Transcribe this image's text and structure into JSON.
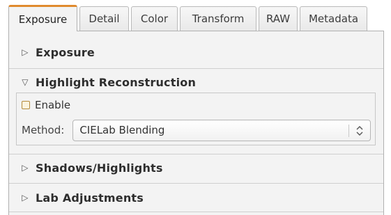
{
  "tabs": [
    {
      "label": "Exposure",
      "active": true
    },
    {
      "label": "Detail",
      "active": false
    },
    {
      "label": "Color",
      "active": false
    },
    {
      "label": "Transform",
      "active": false
    },
    {
      "label": "RAW",
      "active": false
    },
    {
      "label": "Metadata",
      "active": false
    }
  ],
  "sections": {
    "exposure": {
      "title": "Exposure",
      "expanded": false,
      "icon": "triangle-right-icon"
    },
    "highlight_reconstruction": {
      "title": "Highlight Reconstruction",
      "expanded": true,
      "icon": "triangle-down-icon",
      "enable_label": "Enable",
      "enable_checked": false,
      "method_label": "Method:",
      "method_value": "CIELab Blending"
    },
    "shadows_highlights": {
      "title": "Shadows/Highlights",
      "expanded": false,
      "icon": "triangle-right-icon"
    },
    "lab_adjustments": {
      "title": "Lab Adjustments",
      "expanded": false,
      "icon": "triangle-right-icon"
    }
  },
  "colors": {
    "active_tab_accent": "#e08a2e",
    "page_background": "#f3f3f3",
    "checkbox_border": "#b58b3a"
  }
}
